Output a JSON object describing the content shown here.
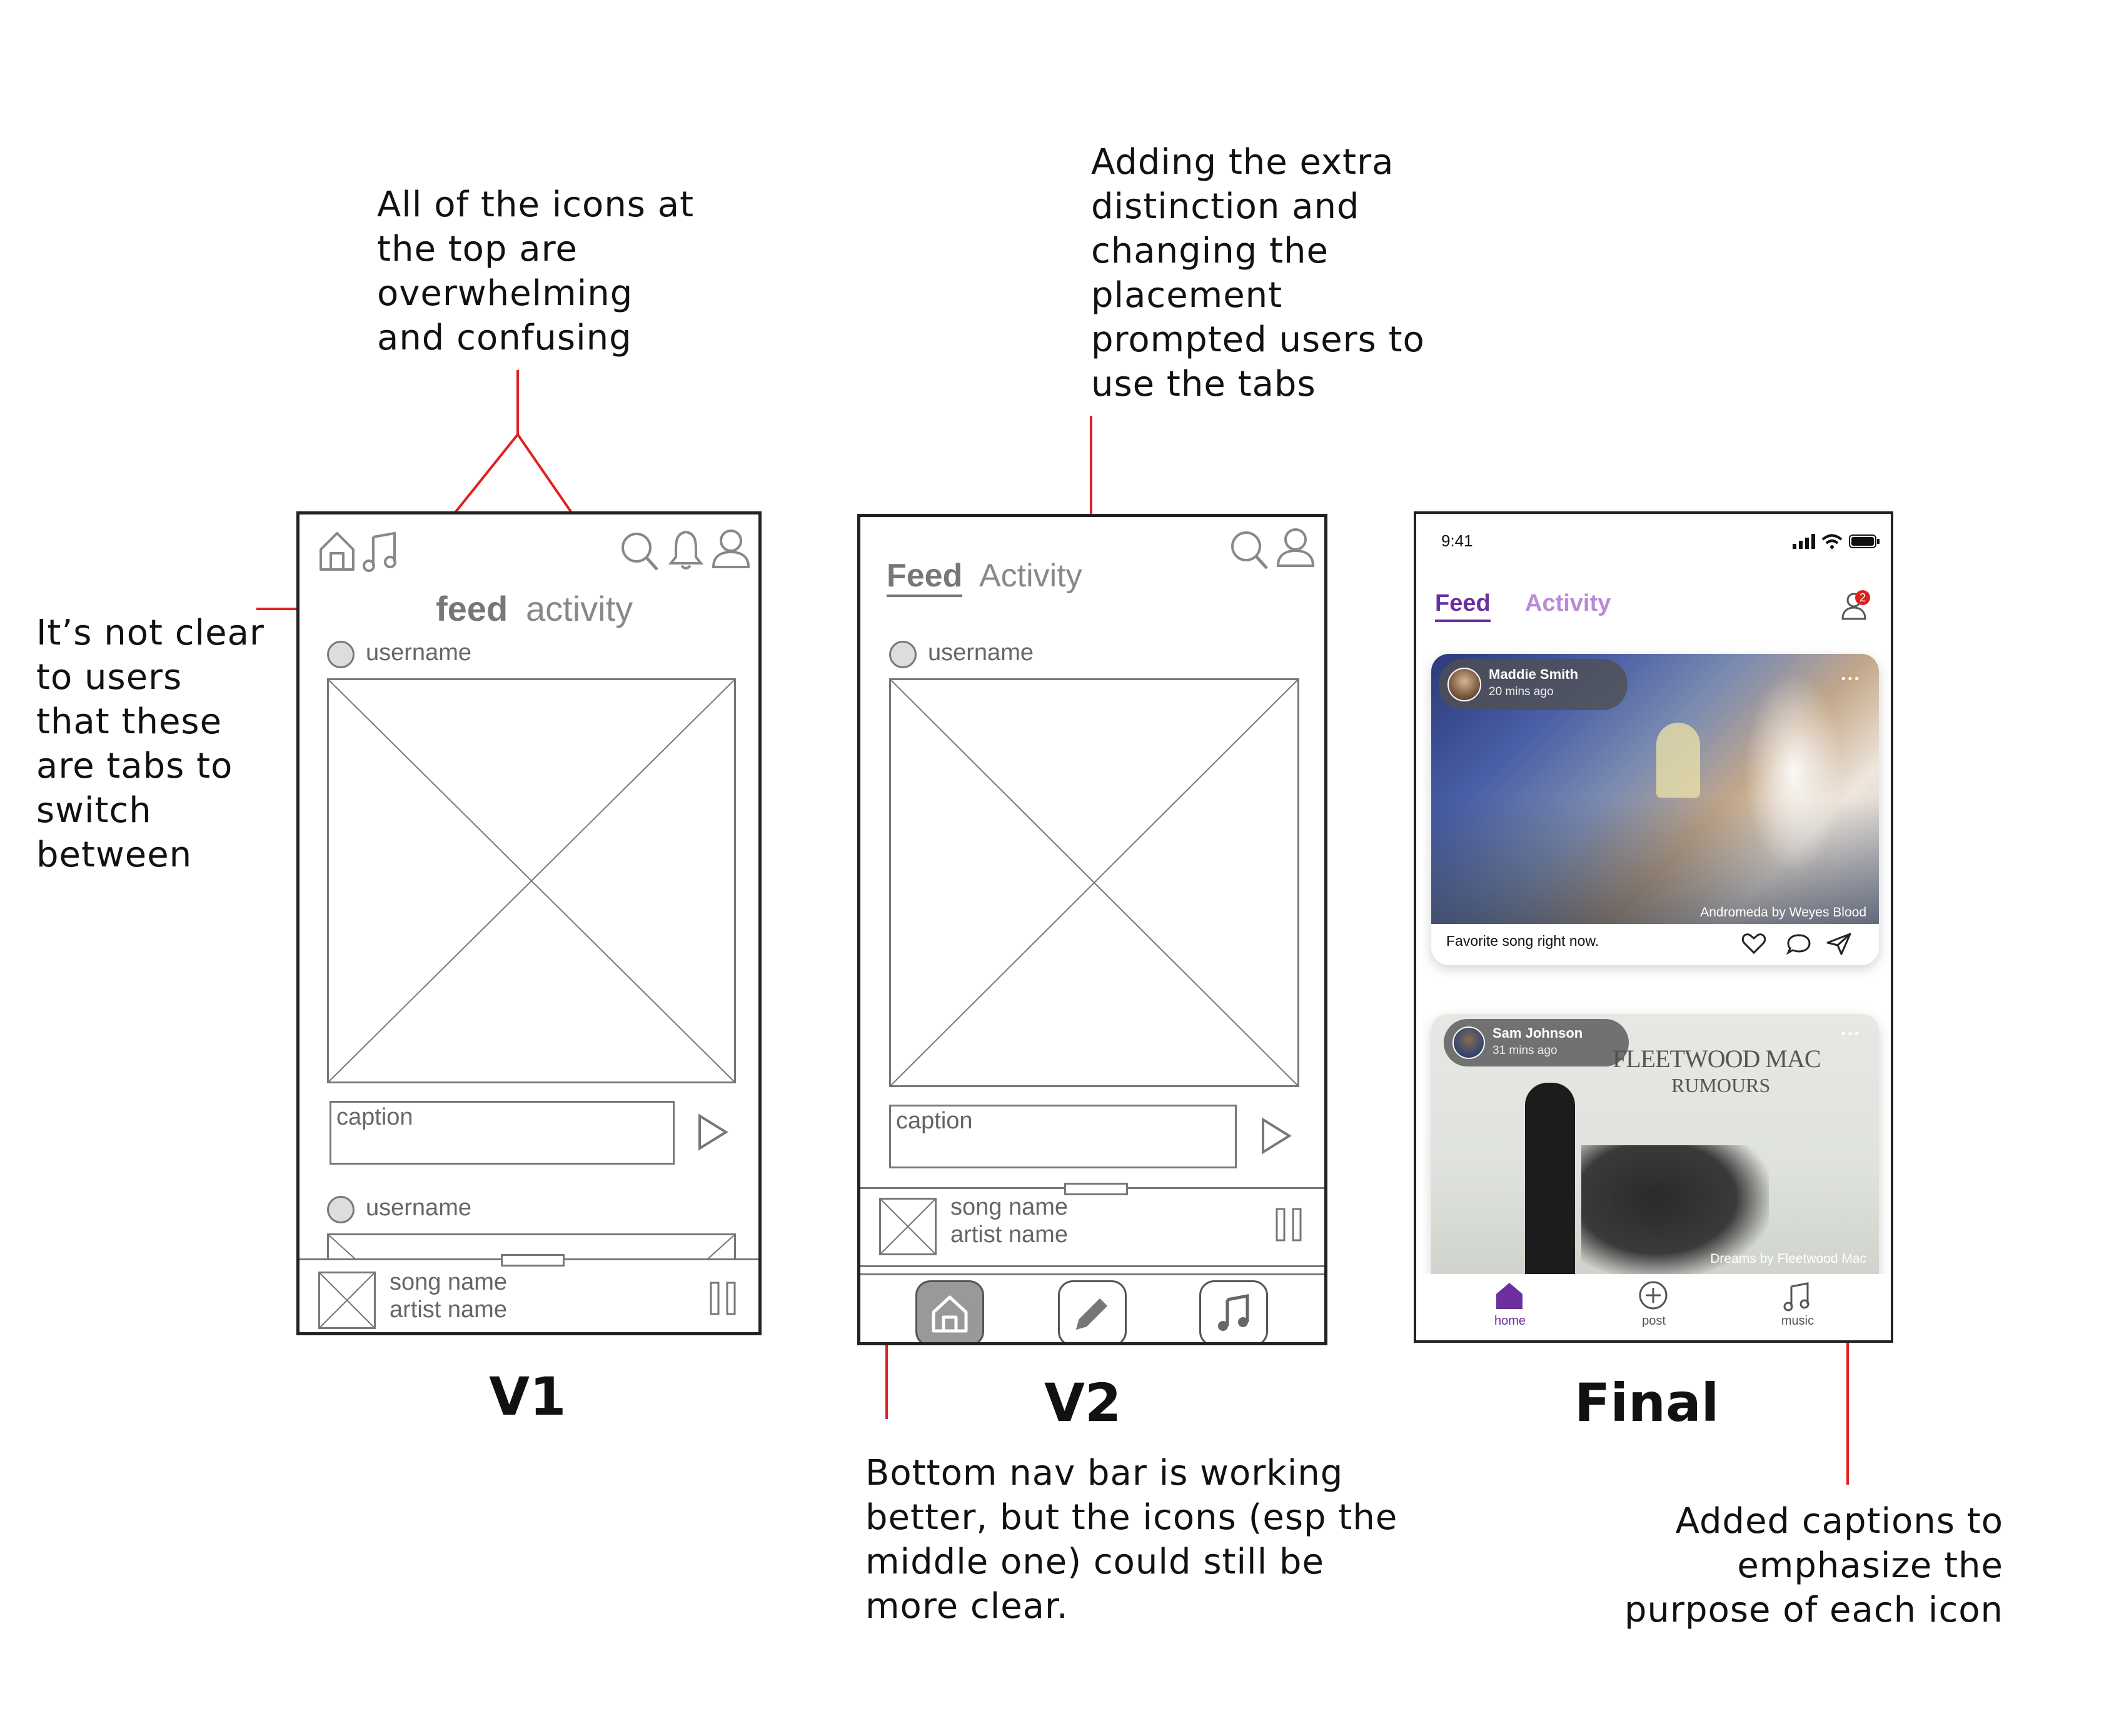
{
  "annotations": {
    "icons_top": "All of the icons at\nthe top are\noverwhelming\nand confusing",
    "tabs_unclear": "It’s not clear\nto users\nthat these\nare tabs to\nswitch\nbetween",
    "extra_distinction": "Adding the extra\ndistinction and\nchanging the\nplacement\nprompted users to\nuse the tabs",
    "bottom_nav": "Bottom nav bar is working\nbetter, but the icons (esp the\nmiddle one) could still be\nmore clear.",
    "captions": "Added captions to\nemphasize the\npurpose of each icon"
  },
  "labels": {
    "v1": "V1",
    "v2": "V2",
    "final": "Final"
  },
  "v1": {
    "tab_feed": "feed",
    "tab_activity": "activity",
    "username": "username",
    "caption_placeholder": "caption",
    "username2": "username",
    "song_name": "song name",
    "artist_name": "artist name"
  },
  "v2": {
    "tab_feed": "Feed",
    "tab_activity": "Activity",
    "username": "username",
    "caption_placeholder": "caption",
    "song_name": "song name",
    "artist_name": "artist name"
  },
  "final": {
    "time": "9:41",
    "tab_feed": "Feed",
    "tab_activity": "Activity",
    "notification_count": "2",
    "post1": {
      "user": "Maddie Smith",
      "time": "20 mins ago",
      "song": "Andromeda by Weyes Blood",
      "caption": "Favorite song right now.",
      "more": "•••"
    },
    "post2": {
      "user": "Sam Johnson",
      "time": "31 mins ago",
      "song": "Dreams by Fleetwood Mac",
      "album_title": "FLEETWOOD MAC",
      "album_subtitle": "RUMOURS",
      "more": "•••"
    },
    "nav": {
      "home": "home",
      "post": "post",
      "music": "music"
    }
  },
  "colors": {
    "accent": "#6b2fa0",
    "accent_light": "#b98ad6",
    "annotation": "#e0201f",
    "badge": "#e0201f"
  }
}
